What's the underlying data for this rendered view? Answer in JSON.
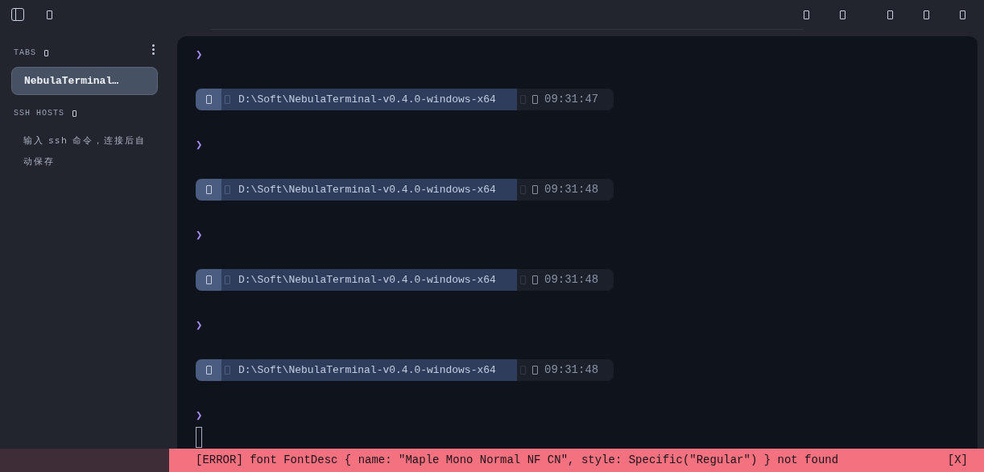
{
  "sidebar": {
    "tabs_heading": "TABS",
    "tabs": [
      {
        "label": "NebulaTerminal…",
        "selected": true
      }
    ],
    "ssh_heading": "SSH HOSTS",
    "ssh_hint": "输入 ssh 命令，连接后自动保存"
  },
  "terminal": {
    "prompt_symbol": "❯",
    "entries": [
      {
        "path": "D:\\Soft\\NebulaTerminal-v0.4.0-windows-x64",
        "time": "09:31:47"
      },
      {
        "path": "D:\\Soft\\NebulaTerminal-v0.4.0-windows-x64",
        "time": "09:31:48"
      },
      {
        "path": "D:\\Soft\\NebulaTerminal-v0.4.0-windows-x64",
        "time": "09:31:48"
      },
      {
        "path": "D:\\Soft\\NebulaTerminal-v0.4.0-windows-x64",
        "time": "09:31:48"
      }
    ]
  },
  "error_bar": {
    "message": "[ERROR] font FontDesc { name: \"Maple Mono Normal NF CN\", style: Specific(\"Regular\") } not found",
    "close": "[X]"
  }
}
